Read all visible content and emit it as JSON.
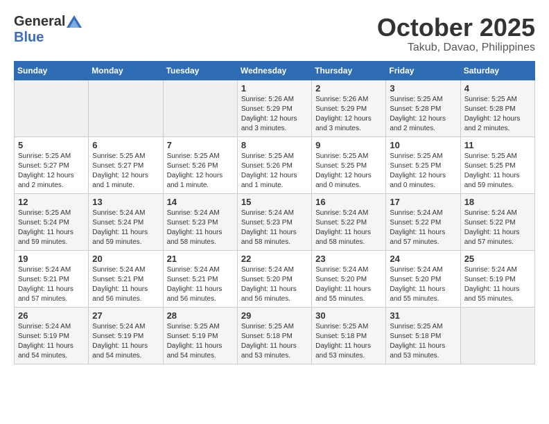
{
  "header": {
    "logo_general": "General",
    "logo_blue": "Blue",
    "month_title": "October 2025",
    "location": "Takub, Davao, Philippines"
  },
  "calendar": {
    "days_of_week": [
      "Sunday",
      "Monday",
      "Tuesday",
      "Wednesday",
      "Thursday",
      "Friday",
      "Saturday"
    ],
    "weeks": [
      [
        {
          "day": "",
          "info": ""
        },
        {
          "day": "",
          "info": ""
        },
        {
          "day": "",
          "info": ""
        },
        {
          "day": "1",
          "info": "Sunrise: 5:26 AM\nSunset: 5:29 PM\nDaylight: 12 hours and 3 minutes."
        },
        {
          "day": "2",
          "info": "Sunrise: 5:26 AM\nSunset: 5:29 PM\nDaylight: 12 hours and 3 minutes."
        },
        {
          "day": "3",
          "info": "Sunrise: 5:25 AM\nSunset: 5:28 PM\nDaylight: 12 hours and 2 minutes."
        },
        {
          "day": "4",
          "info": "Sunrise: 5:25 AM\nSunset: 5:28 PM\nDaylight: 12 hours and 2 minutes."
        }
      ],
      [
        {
          "day": "5",
          "info": "Sunrise: 5:25 AM\nSunset: 5:27 PM\nDaylight: 12 hours and 2 minutes."
        },
        {
          "day": "6",
          "info": "Sunrise: 5:25 AM\nSunset: 5:27 PM\nDaylight: 12 hours and 1 minute."
        },
        {
          "day": "7",
          "info": "Sunrise: 5:25 AM\nSunset: 5:26 PM\nDaylight: 12 hours and 1 minute."
        },
        {
          "day": "8",
          "info": "Sunrise: 5:25 AM\nSunset: 5:26 PM\nDaylight: 12 hours and 1 minute."
        },
        {
          "day": "9",
          "info": "Sunrise: 5:25 AM\nSunset: 5:25 PM\nDaylight: 12 hours and 0 minutes."
        },
        {
          "day": "10",
          "info": "Sunrise: 5:25 AM\nSunset: 5:25 PM\nDaylight: 12 hours and 0 minutes."
        },
        {
          "day": "11",
          "info": "Sunrise: 5:25 AM\nSunset: 5:25 PM\nDaylight: 11 hours and 59 minutes."
        }
      ],
      [
        {
          "day": "12",
          "info": "Sunrise: 5:25 AM\nSunset: 5:24 PM\nDaylight: 11 hours and 59 minutes."
        },
        {
          "day": "13",
          "info": "Sunrise: 5:24 AM\nSunset: 5:24 PM\nDaylight: 11 hours and 59 minutes."
        },
        {
          "day": "14",
          "info": "Sunrise: 5:24 AM\nSunset: 5:23 PM\nDaylight: 11 hours and 58 minutes."
        },
        {
          "day": "15",
          "info": "Sunrise: 5:24 AM\nSunset: 5:23 PM\nDaylight: 11 hours and 58 minutes."
        },
        {
          "day": "16",
          "info": "Sunrise: 5:24 AM\nSunset: 5:22 PM\nDaylight: 11 hours and 58 minutes."
        },
        {
          "day": "17",
          "info": "Sunrise: 5:24 AM\nSunset: 5:22 PM\nDaylight: 11 hours and 57 minutes."
        },
        {
          "day": "18",
          "info": "Sunrise: 5:24 AM\nSunset: 5:22 PM\nDaylight: 11 hours and 57 minutes."
        }
      ],
      [
        {
          "day": "19",
          "info": "Sunrise: 5:24 AM\nSunset: 5:21 PM\nDaylight: 11 hours and 57 minutes."
        },
        {
          "day": "20",
          "info": "Sunrise: 5:24 AM\nSunset: 5:21 PM\nDaylight: 11 hours and 56 minutes."
        },
        {
          "day": "21",
          "info": "Sunrise: 5:24 AM\nSunset: 5:21 PM\nDaylight: 11 hours and 56 minutes."
        },
        {
          "day": "22",
          "info": "Sunrise: 5:24 AM\nSunset: 5:20 PM\nDaylight: 11 hours and 56 minutes."
        },
        {
          "day": "23",
          "info": "Sunrise: 5:24 AM\nSunset: 5:20 PM\nDaylight: 11 hours and 55 minutes."
        },
        {
          "day": "24",
          "info": "Sunrise: 5:24 AM\nSunset: 5:20 PM\nDaylight: 11 hours and 55 minutes."
        },
        {
          "day": "25",
          "info": "Sunrise: 5:24 AM\nSunset: 5:19 PM\nDaylight: 11 hours and 55 minutes."
        }
      ],
      [
        {
          "day": "26",
          "info": "Sunrise: 5:24 AM\nSunset: 5:19 PM\nDaylight: 11 hours and 54 minutes."
        },
        {
          "day": "27",
          "info": "Sunrise: 5:24 AM\nSunset: 5:19 PM\nDaylight: 11 hours and 54 minutes."
        },
        {
          "day": "28",
          "info": "Sunrise: 5:25 AM\nSunset: 5:19 PM\nDaylight: 11 hours and 54 minutes."
        },
        {
          "day": "29",
          "info": "Sunrise: 5:25 AM\nSunset: 5:18 PM\nDaylight: 11 hours and 53 minutes."
        },
        {
          "day": "30",
          "info": "Sunrise: 5:25 AM\nSunset: 5:18 PM\nDaylight: 11 hours and 53 minutes."
        },
        {
          "day": "31",
          "info": "Sunrise: 5:25 AM\nSunset: 5:18 PM\nDaylight: 11 hours and 53 minutes."
        },
        {
          "day": "",
          "info": ""
        }
      ]
    ]
  }
}
